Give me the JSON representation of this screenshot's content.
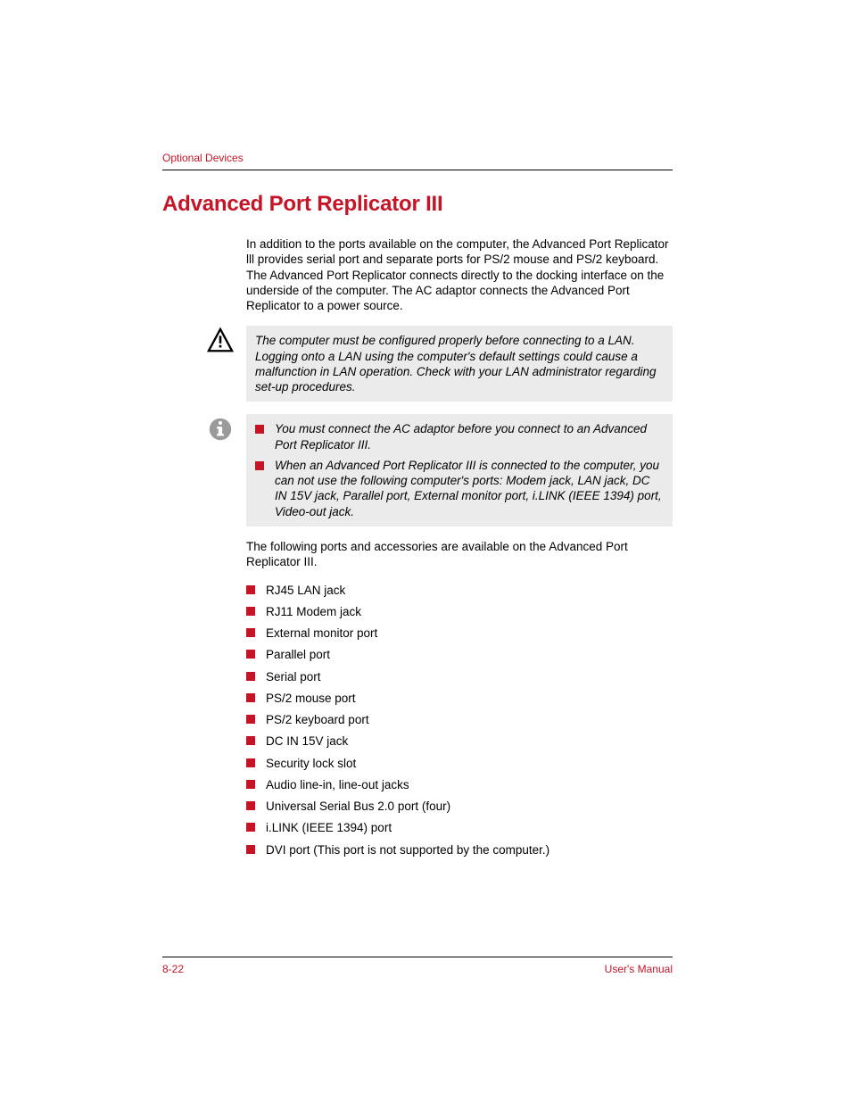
{
  "header": {
    "label": "Optional Devices"
  },
  "title": "Advanced Port Replicator III",
  "intro": "In addition to the ports available on the computer, the Advanced Port Replicator lll provides serial port and separate ports for PS/2 mouse and PS/2 keyboard. The Advanced Port Replicator connects directly to the docking interface on the underside of the computer. The AC adaptor connects the Advanced Port Replicator to a power source.",
  "warning": "The computer must be configured properly before connecting to a LAN. Logging onto a LAN using the computer's default settings could cause a malfunction in LAN operation. Check with your LAN administrator regarding set-up procedures.",
  "info": {
    "item1": "You must connect the AC adaptor before you connect to an Advanced Port Replicator III.",
    "item2": "When an Advanced Port Replicator III is connected to the computer, you can not use the following computer's ports: Modem jack, LAN jack, DC IN 15V jack, Parallel port, External monitor port, i.LINK (IEEE 1394) port, Video-out jack."
  },
  "list_intro": "The following ports and accessories are available on the Advanced Port Replicator III.",
  "ports": {
    "p0": "RJ45 LAN jack",
    "p1": "RJ11 Modem jack",
    "p2": "External monitor port",
    "p3": "Parallel port",
    "p4": "Serial port",
    "p5": "PS/2 mouse port",
    "p6": "PS/2 keyboard port",
    "p7": "DC IN 15V jack",
    "p8": "Security lock slot",
    "p9": "Audio line-in, line-out jacks",
    "p10": "Universal Serial Bus 2.0 port (four)",
    "p11": "i.LINK (IEEE 1394) port",
    "p12": "DVI port (This port is not supported by the computer.)"
  },
  "footer": {
    "page": "8-22",
    "doc": "User's Manual"
  }
}
